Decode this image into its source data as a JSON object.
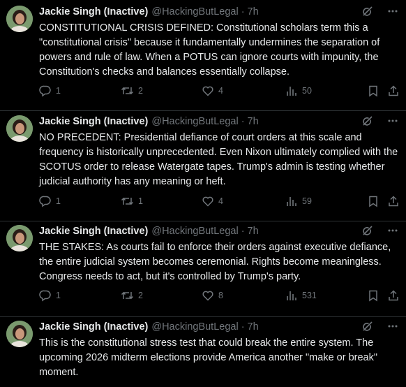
{
  "tweets": [
    {
      "name": "Jackie Singh (Inactive)",
      "handle": "@HackingButLegal",
      "sep": "·",
      "time": "7h",
      "text": "CONSTITUTIONAL CRISIS DEFINED: Constitutional scholars term this a \"constitutional crisis\" because it fundamentally undermines the separation of powers and rule of law. When a POTUS can ignore courts with impunity, the Constitution's checks and balances essentially collapse.",
      "replies": "1",
      "reposts": "2",
      "likes": "4",
      "views": "50"
    },
    {
      "name": "Jackie Singh (Inactive)",
      "handle": "@HackingButLegal",
      "sep": "·",
      "time": "7h",
      "text": "NO PRECEDENT: Presidential defiance of court orders at this scale and frequency is historically unprecedented. Even Nixon ultimately complied with the SCOTUS order to release Watergate tapes. Trump's admin is testing whether judicial authority has any meaning or heft.",
      "replies": "1",
      "reposts": "1",
      "likes": "4",
      "views": "59"
    },
    {
      "name": "Jackie Singh (Inactive)",
      "handle": "@HackingButLegal",
      "sep": "·",
      "time": "7h",
      "text": "THE STAKES: As courts fail to enforce their orders against executive defiance, the entire judicial system becomes ceremonial. Rights become meaningless. Congress needs to act, but it's controlled by Trump's party.",
      "replies": "1",
      "reposts": "2",
      "likes": "8",
      "views": "531"
    },
    {
      "name": "Jackie Singh (Inactive)",
      "handle": "@HackingButLegal",
      "sep": "·",
      "time": "7h",
      "text": "This is the constitutional stress test that could break the entire system. The upcoming 2026 midterm elections provide America another \"make or break\" moment."
    }
  ],
  "icons": {
    "grok": "grok-icon",
    "more": "more-icon",
    "reply": "reply-icon",
    "repost": "repost-icon",
    "like": "like-icon",
    "views": "views-icon",
    "bookmark": "bookmark-icon",
    "share": "share-icon"
  },
  "colors": {
    "background": "#000000",
    "text": "#e7e9ea",
    "muted": "#71767b",
    "divider": "#2f3336"
  }
}
